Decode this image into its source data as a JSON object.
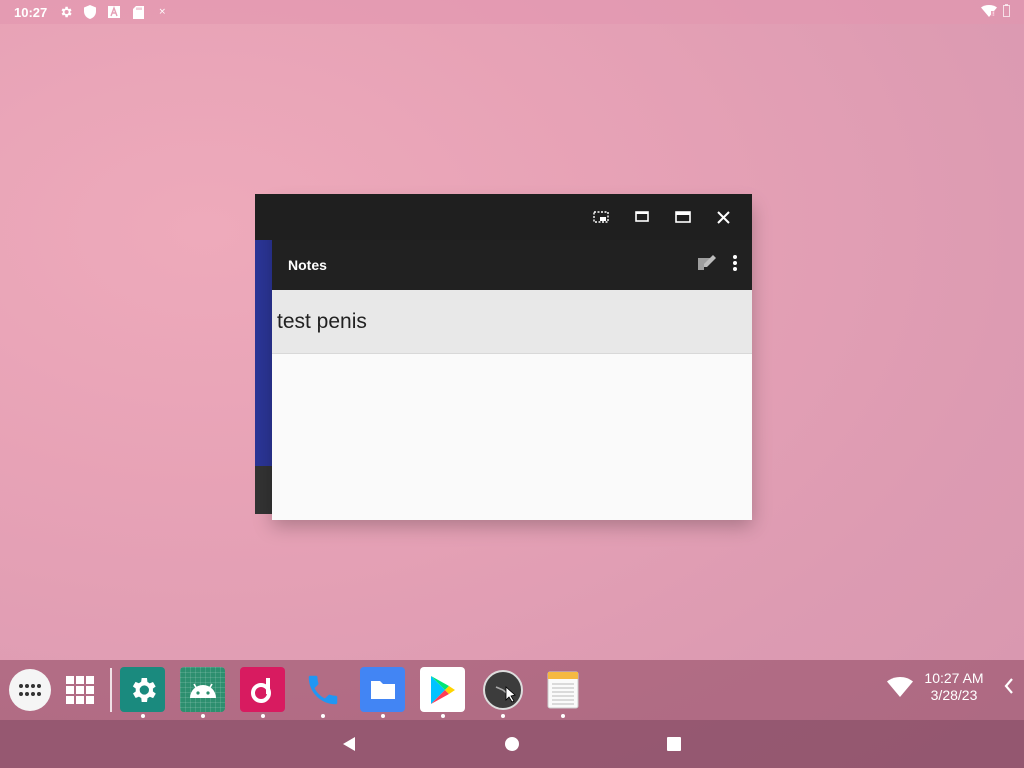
{
  "status_bar": {
    "time": "10:27",
    "icons": [
      "settings-icon",
      "shield-icon",
      "font-icon",
      "sd-card-icon",
      "small-dot-icon"
    ],
    "right_icons": [
      "wifi-icon",
      "battery-icon"
    ]
  },
  "window": {
    "controls": [
      "restore-icon",
      "maximize-icon",
      "fullscreen-icon",
      "close-icon"
    ]
  },
  "notes_app": {
    "title": "Notes",
    "actions": [
      "edit-note-icon",
      "more-vert-icon"
    ],
    "notes": [
      {
        "title": "test penis"
      }
    ]
  },
  "taskbar": {
    "apps": [
      {
        "name": "settings",
        "color": "#1a8a7e"
      },
      {
        "name": "android",
        "color": "#2d8f6f"
      },
      {
        "name": "music",
        "color": "#d81b60"
      },
      {
        "name": "phone",
        "color": "#2196f3"
      },
      {
        "name": "files",
        "color": "#4285f4"
      },
      {
        "name": "play-store",
        "color": "#ffffff"
      },
      {
        "name": "clock",
        "color": "#3c3c3c"
      },
      {
        "name": "notepad",
        "color": "#f5d46b"
      }
    ],
    "clock_time": "10:27 AM",
    "clock_date": "3/28/23"
  },
  "nav": [
    "back-icon",
    "home-icon",
    "recents-icon"
  ]
}
